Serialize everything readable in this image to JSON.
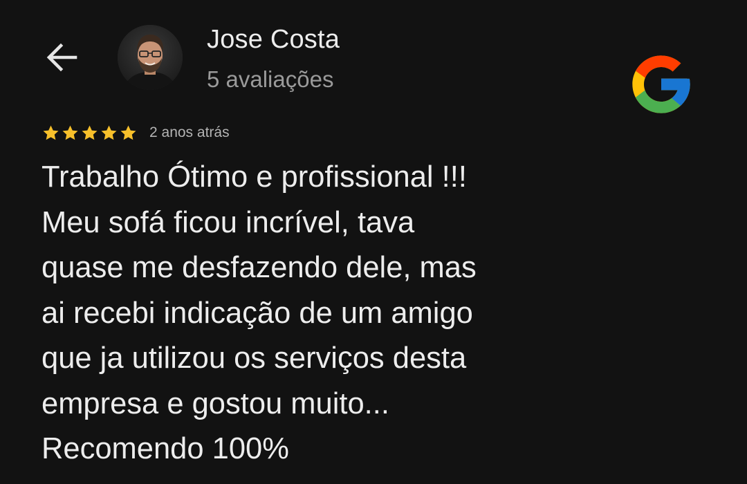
{
  "header": {
    "back_icon": "arrow-left-icon",
    "reviewer": {
      "name": "Jose Costa",
      "reviews_count": "5 avaliações",
      "avatar_icon": "avatar-photo"
    },
    "brand_icon": "google-logo-icon",
    "brand_colors": {
      "red": "#EA4335",
      "yellow": "#FBBC05",
      "green": "#34A853",
      "blue": "#4285F4"
    }
  },
  "review": {
    "rating": 5,
    "max_rating": 5,
    "star_color": "#F7C02B",
    "date": "2 anos atrás",
    "text": "Trabalho Ótimo e profissional !!!\nMeu sofá ficou incrível, tava\nquase me desfazendo dele, mas\nai recebi indicação de um amigo\nque ja utilizou os serviços desta\nempresa e gostou muito...\nRecomendo 100%"
  }
}
